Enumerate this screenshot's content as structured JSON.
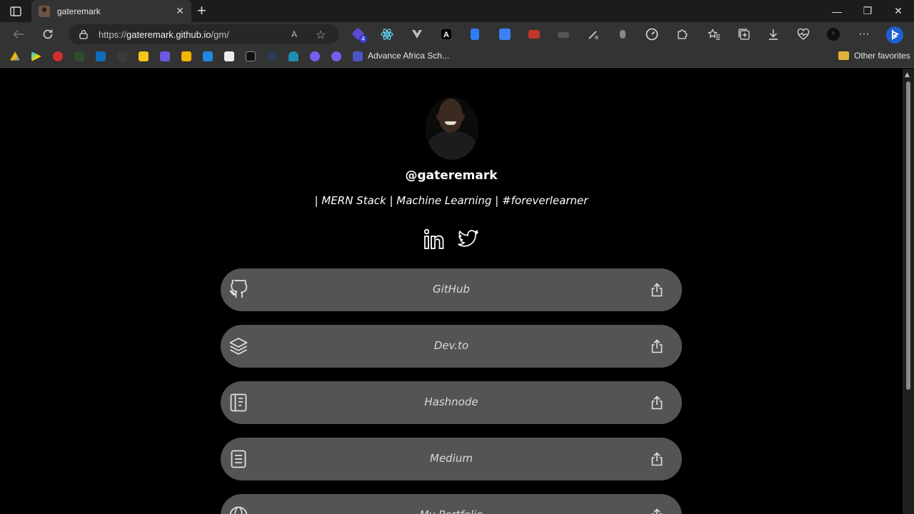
{
  "browser": {
    "tab_title": "gateremark",
    "tab_close": "✕",
    "new_tab": "+",
    "url_scheme": "https://",
    "url_host": "gateremark.github.io",
    "url_path": "/gm/",
    "read_aloud": "A",
    "window_controls": {
      "minimize": "—",
      "restore": "❐",
      "close": "✕"
    },
    "extension_badge": "4",
    "bookmark_label": "Advance Africa Sch...",
    "other_favorites": "Other favorites"
  },
  "profile": {
    "handle": "@gateremark",
    "bio": "| MERN Stack | Machine Learning | #foreverlearner"
  },
  "social": [
    {
      "name": "linkedin-icon"
    },
    {
      "name": "twitter-icon"
    }
  ],
  "links": [
    {
      "label": "GitHub",
      "icon": "github-icon"
    },
    {
      "label": "Dev.to",
      "icon": "layers-icon"
    },
    {
      "label": "Hashnode",
      "icon": "notebook-icon"
    },
    {
      "label": "Medium",
      "icon": "document-icon"
    },
    {
      "label": "My Portfolio",
      "icon": "globe-icon"
    }
  ],
  "colors": {
    "page_bg": "#000000",
    "link_bg": "#545454",
    "chrome_bg": "#333333"
  }
}
